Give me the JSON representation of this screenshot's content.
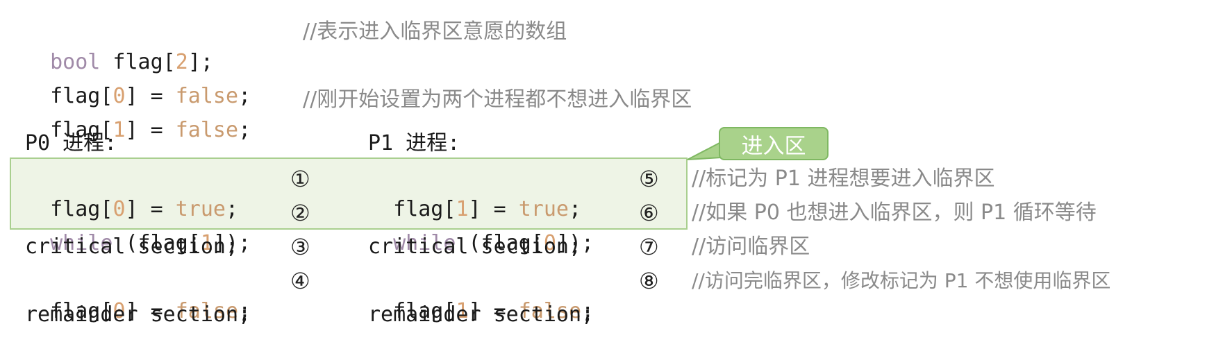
{
  "decl": {
    "l1": {
      "kw": "bool",
      "rest": " flag[",
      "num": "2",
      "tail": "];",
      "comment": "//表示进入临界区意愿的数组"
    },
    "l2": {
      "a": "flag[",
      "num": "0",
      "b": "] = ",
      "lit": "false",
      "c": ";"
    },
    "l3": {
      "a": "flag[",
      "num": "1",
      "b": "] = ",
      "lit": "false",
      "c": ";",
      "comment": "//刚开始设置为两个进程都不想进入临界区"
    }
  },
  "headers": {
    "p0": "P0 进程:",
    "p1": "P1 进程:"
  },
  "callout": "进入区",
  "p0": {
    "r1": {
      "a": "flag[",
      "num": "0",
      "b": "] = ",
      "lit": "true",
      "c": ";"
    },
    "r2": {
      "kw": "while",
      "a": " (flag[",
      "num": "1",
      "b": "]);"
    },
    "r3": "critical section;",
    "r4": {
      "a": "flag[",
      "num": "0",
      "b": "] = ",
      "lit": "false",
      "c": ";"
    },
    "r5": "remainder section;"
  },
  "p1": {
    "r1": {
      "a": "flag[",
      "num": "1",
      "b": "] = ",
      "lit": "true",
      "c": ";"
    },
    "r2": {
      "kw": "while",
      "a": " (flag[",
      "num": "0",
      "b": "]);"
    },
    "r3": "critical section;",
    "r4": {
      "a": "flag[",
      "num": "1",
      "b": "] = ",
      "lit": "false",
      "c": ";"
    },
    "r5": "remainder section;"
  },
  "markers": [
    "①",
    "②",
    "③",
    "④",
    "⑤",
    "⑥",
    "⑦",
    "⑧"
  ],
  "comments": {
    "c1": "//标记为 P1 进程想要进入临界区",
    "c2": "//如果 P0 也想进入临界区，则 P1 循环等待",
    "c3": "//访问临界区",
    "c4": "//访问完临界区，修改标记为 P1 不想使用临界区"
  }
}
